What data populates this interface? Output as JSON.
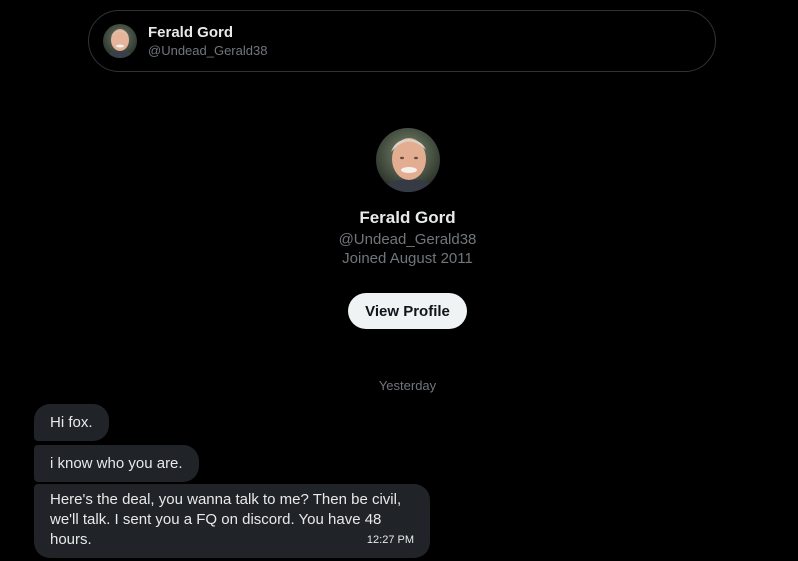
{
  "header": {
    "name": "Ferald Gord",
    "handle": "@Undead_Gerald38"
  },
  "profile": {
    "name": "Ferald Gord",
    "handle": "@Undead_Gerald38",
    "joined": "Joined August 2011",
    "view_profile_label": "View Profile"
  },
  "conversation": {
    "date_divider": "Yesterday",
    "messages": [
      {
        "text": "Hi fox."
      },
      {
        "text": "i know who you are."
      },
      {
        "text": "Here's the deal, you wanna talk to me? Then be civil, we'll talk. I sent you a FQ on discord. You have 48 hours.",
        "time": "12:27 PM"
      }
    ]
  },
  "colors": {
    "background": "#000000",
    "bubble": "#202327",
    "primary_text": "#e7e9ea",
    "secondary_text": "#71767b",
    "button_bg": "#eff3f4"
  }
}
